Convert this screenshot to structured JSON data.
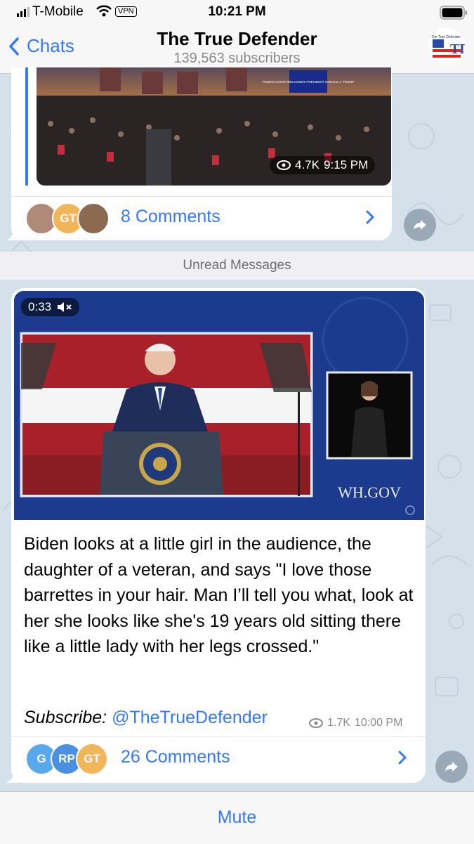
{
  "status_bar": {
    "carrier": "T-Mobile",
    "vpn": "VPN",
    "time": "10:21 PM"
  },
  "nav": {
    "back_label": "Chats",
    "title": "The True Defender",
    "subtitle": "139,563 subscribers",
    "avatar_text": "TD",
    "avatar_caption": "The True Defender"
  },
  "post1": {
    "views": "4.7K",
    "time": "9:15 PM",
    "comments_label": "8 Comments",
    "avatar_initials": "GT",
    "banner_text": "PENNSYLVANIA WELCOMES PRESIDENT DONALD J. TRUMP"
  },
  "unread_label": "Unread Messages",
  "post2": {
    "duration": "0:33",
    "watermark": "WH.GOV",
    "text": "Biden looks at a little girl in the audience, the daughter of a veteran, and says \"I love those barrettes in your hair. Man I’ll tell you what, look at her she looks like she's 19 years old sitting there like a little lady with her legs crossed.\"",
    "subscribe_label": "Subscribe:",
    "subscribe_link": "@TheTrueDefender",
    "views": "1.7K",
    "time": "10:00 PM",
    "comments_label": "26 Comments",
    "avatar_initials": [
      "G",
      "RP",
      "GT"
    ]
  },
  "bottom": {
    "mute_label": "Mute"
  },
  "colors": {
    "accent": "#3478f6",
    "chat_bg": "#d5e1ea",
    "bubble": "#ffffff"
  }
}
